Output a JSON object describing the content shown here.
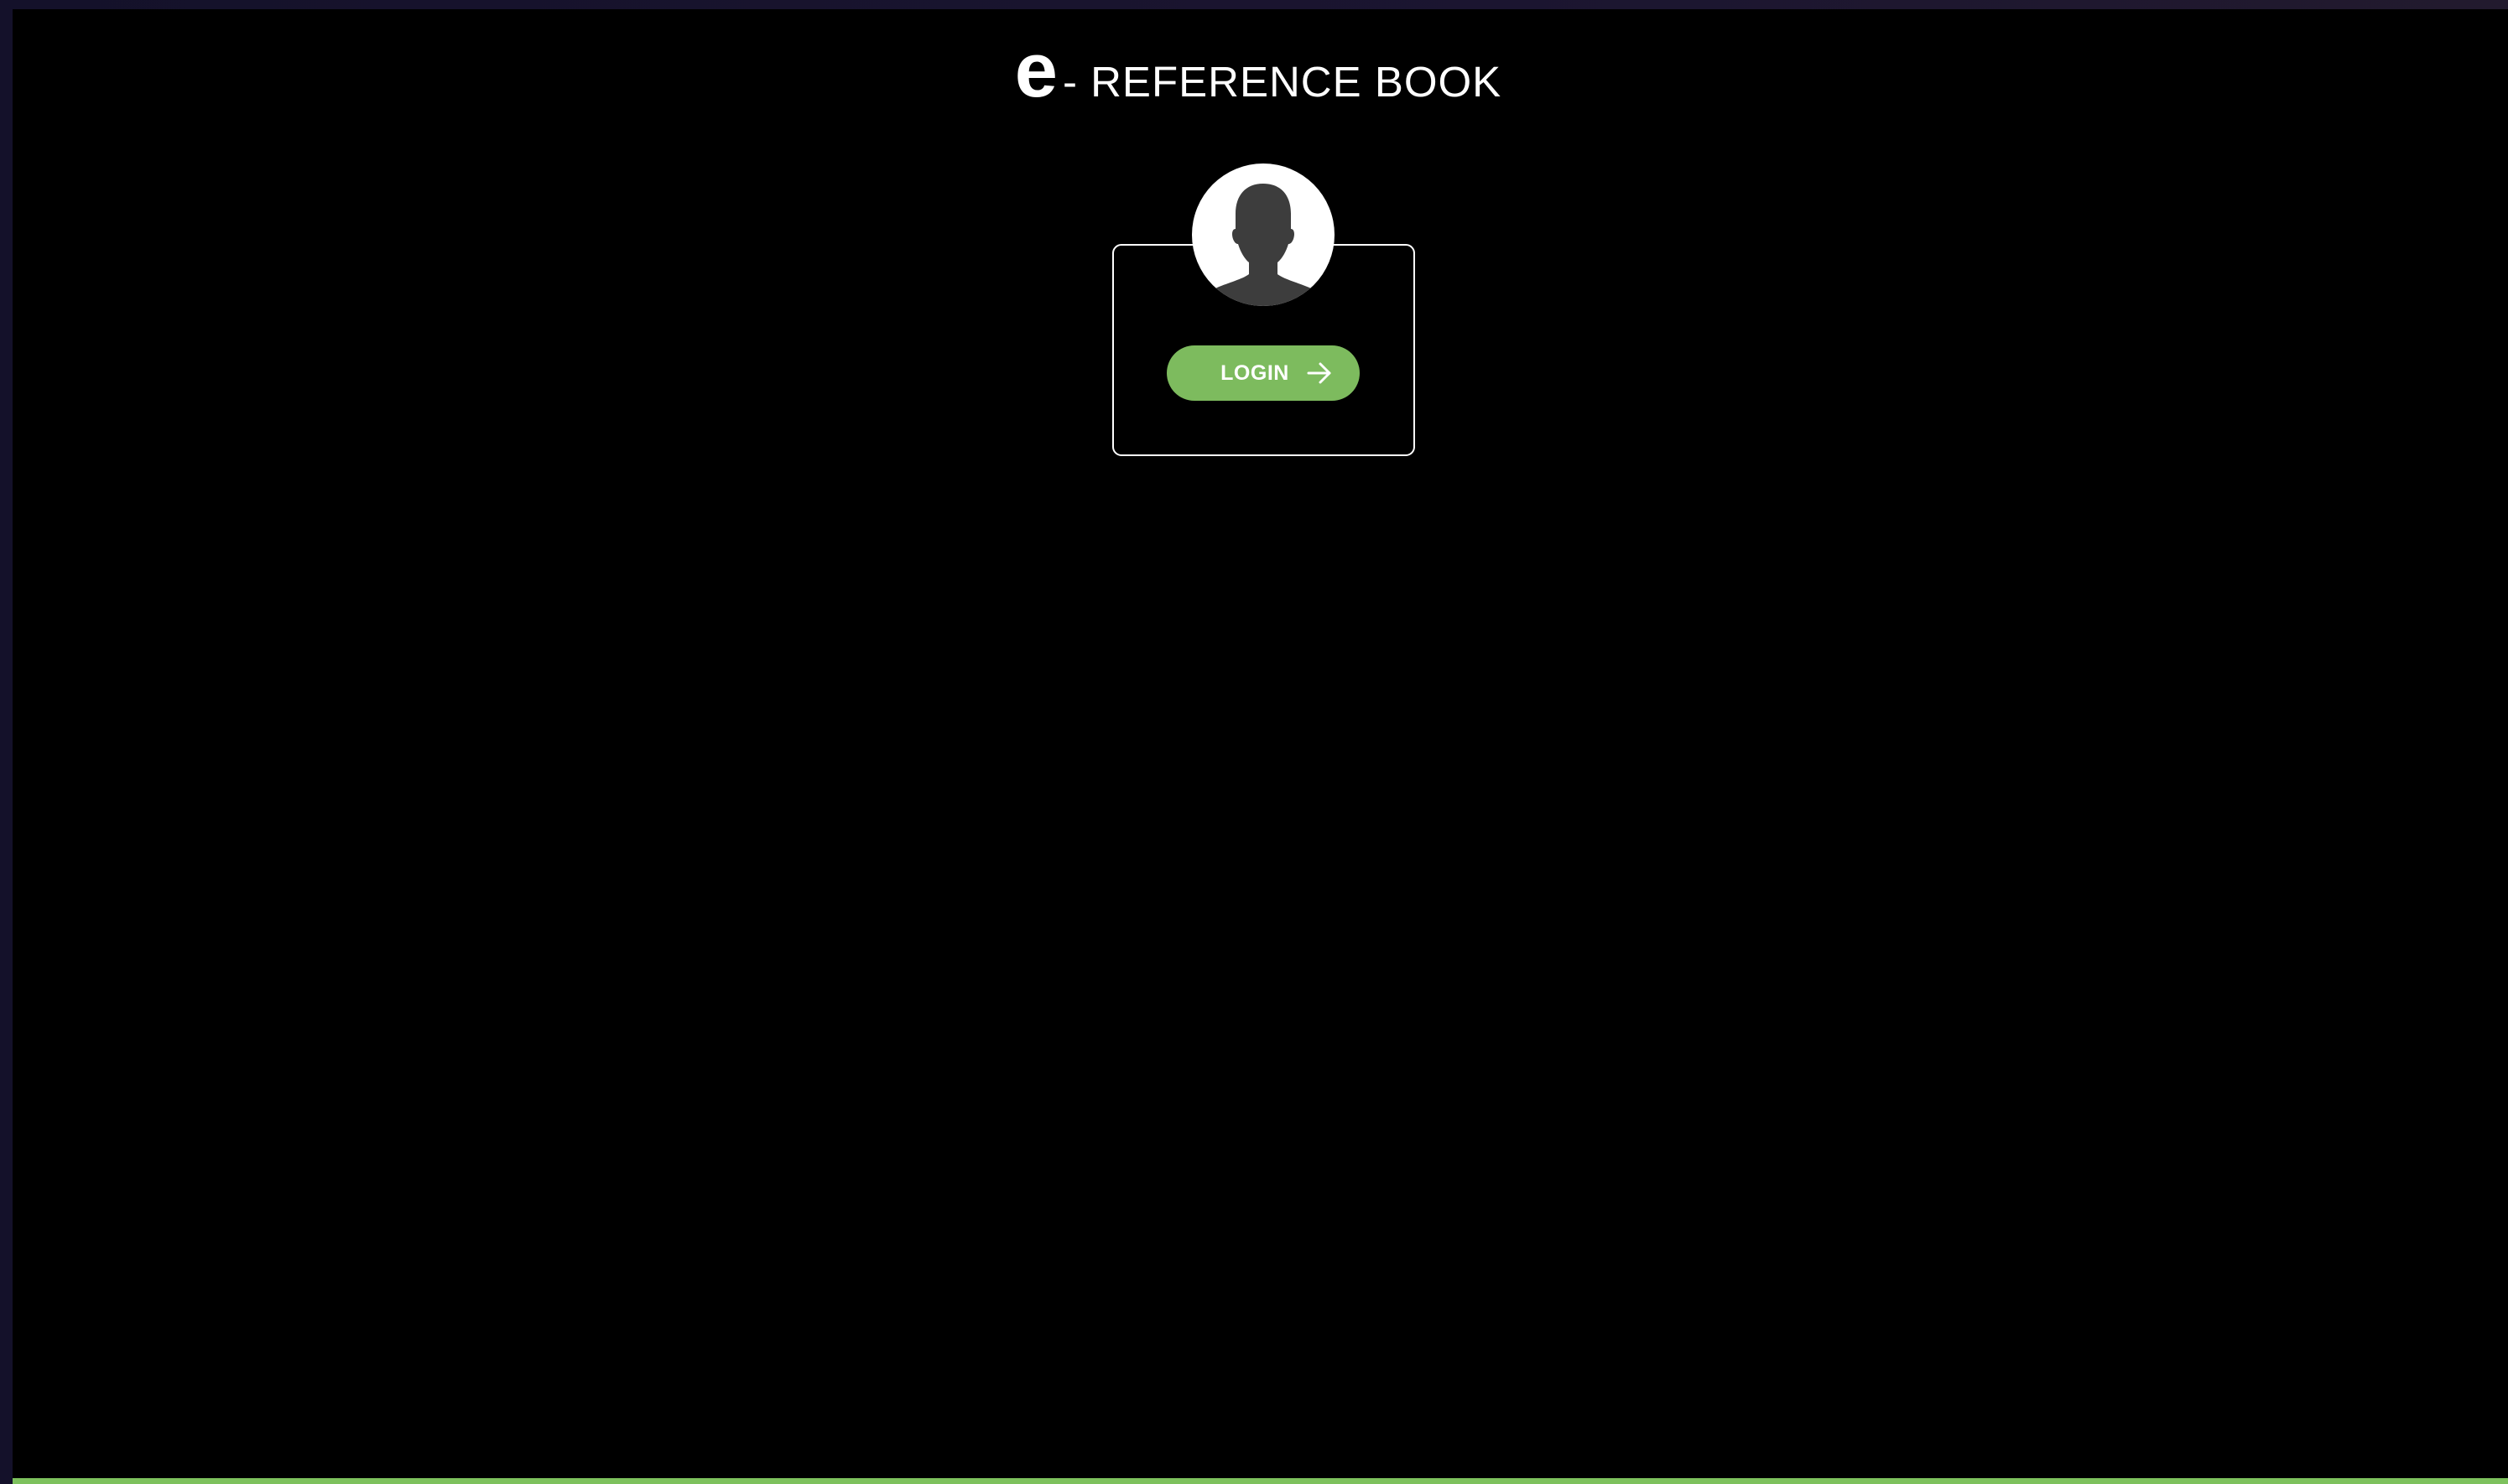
{
  "header": {
    "logo_letter": "e",
    "title_text": "- REFERENCE BOOK"
  },
  "login_card": {
    "avatar_icon": "user-silhouette-icon",
    "login_label": "LOGIN",
    "login_icon": "arrow-right-icon"
  },
  "colors": {
    "background": "#000000",
    "accent": "#7dbb5e",
    "text": "#ffffff",
    "card_border": "#ffffff",
    "avatar_silhouette": "#3d3d3d"
  }
}
